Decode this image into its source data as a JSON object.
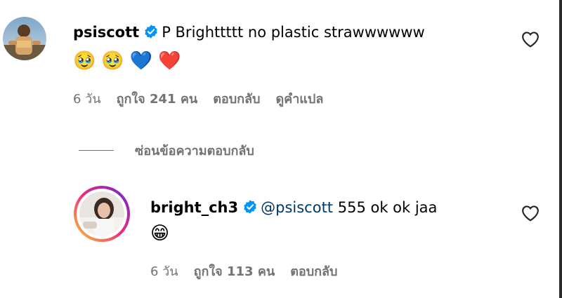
{
  "comment": {
    "username": "psiscott",
    "text": "P Brighttttt no plastic strawwwwww",
    "emojis": [
      "🥹",
      "🥹",
      "💙",
      "❤️"
    ],
    "time": "6 วัน",
    "likes": "ถูกใจ 241 คน",
    "reply_label": "ตอบกลับ",
    "translate_label": "ดูคำแปล"
  },
  "hide_replies_label": "ซ่อนข้อความตอบกลับ",
  "reply": {
    "username": "bright_ch3",
    "mention": "@psiscott",
    "text": " 555 ok ok jaa",
    "emojis": [
      "😁"
    ],
    "time": "6 วัน",
    "likes": "ถูกใจ 113 คน",
    "reply_label": "ตอบกลับ"
  },
  "colors": {
    "meta_text": "#737373",
    "mention": "#00376b",
    "verified_badge": "#0095f6",
    "story_ring_start": "#f9ce34",
    "story_ring_mid": "#ee2a7b",
    "story_ring_end": "#6228d7"
  }
}
